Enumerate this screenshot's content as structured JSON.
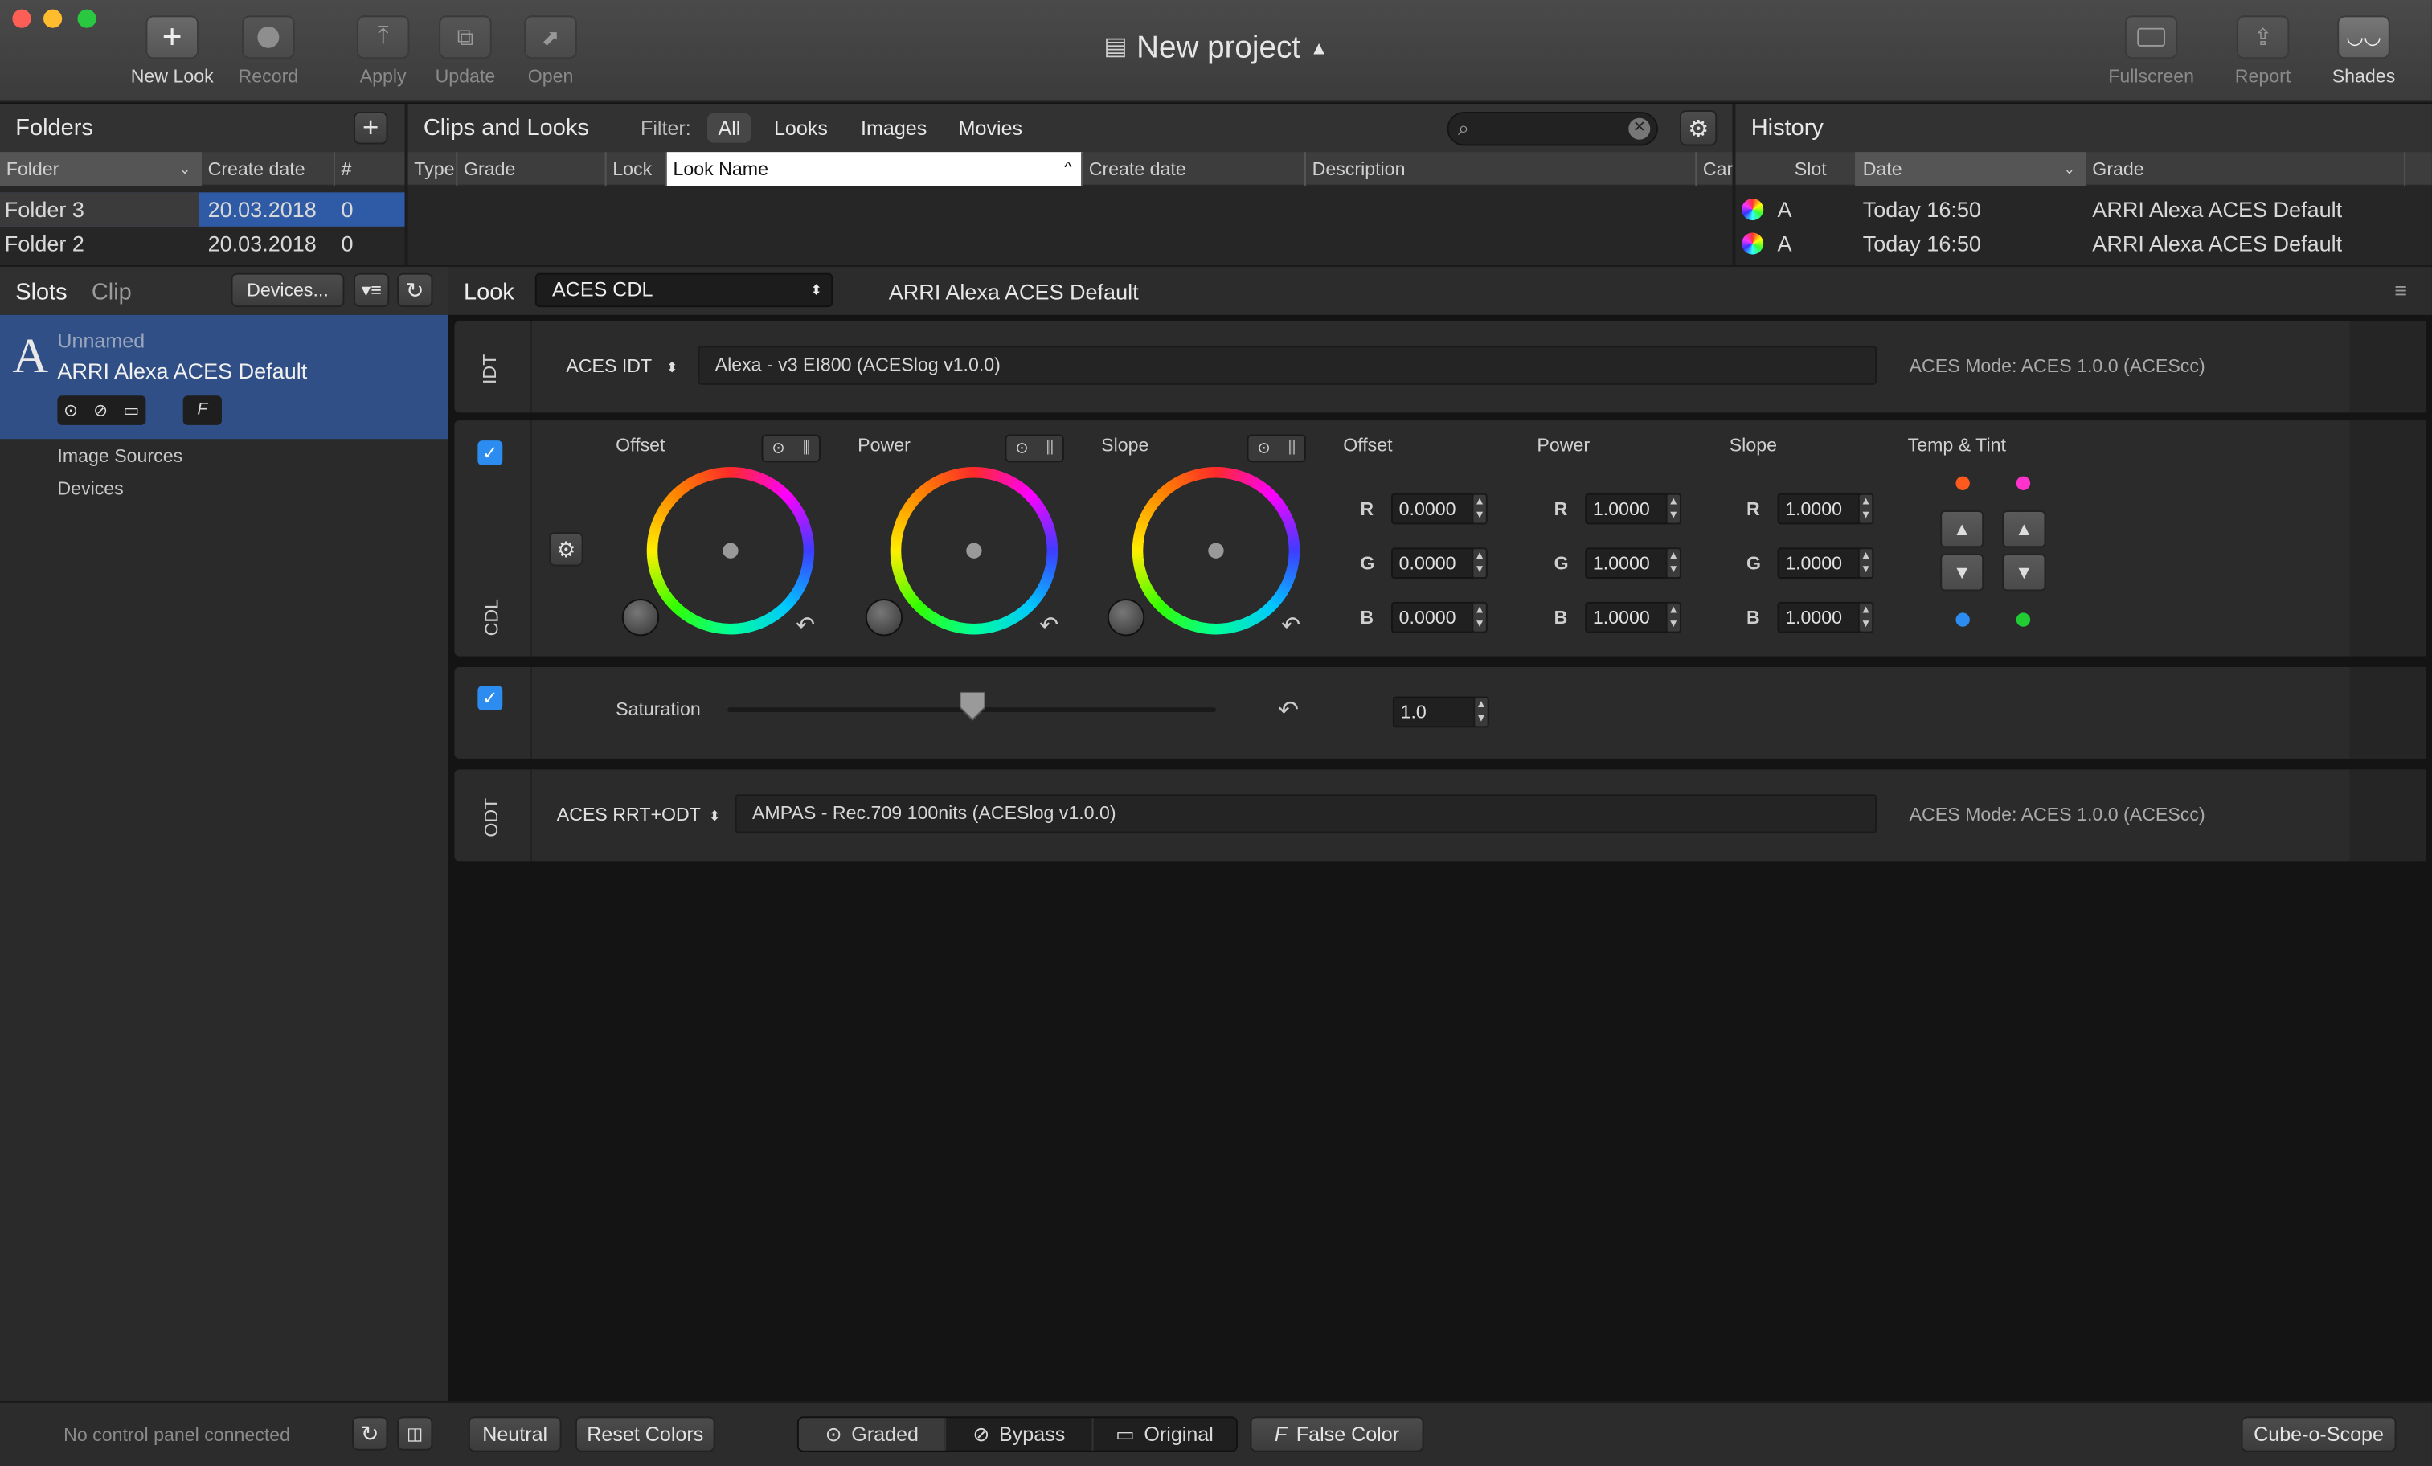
{
  "window": {
    "title": "New project"
  },
  "toolbar": {
    "new_look": "New Look",
    "record": "Record",
    "apply": "Apply",
    "update": "Update",
    "open": "Open",
    "fullscreen": "Fullscreen",
    "report": "Report",
    "shades": "Shades"
  },
  "folders": {
    "title": "Folders",
    "columns": [
      "Folder",
      "Create date",
      "#"
    ],
    "rows": [
      {
        "name": "Folder 3",
        "date": "20.03.2018",
        "count": "0"
      },
      {
        "name": "Folder 2",
        "date": "20.03.2018",
        "count": "0"
      }
    ]
  },
  "clips": {
    "title": "Clips and Looks",
    "filter_label": "Filter:",
    "filters": [
      "All",
      "Looks",
      "Images",
      "Movies"
    ],
    "columns": [
      "Type",
      "Grade",
      "Lock",
      "Look Name",
      "Create date",
      "Description",
      "Car"
    ]
  },
  "history": {
    "title": "History",
    "columns": [
      "Slot",
      "Date",
      "Grade"
    ],
    "rows": [
      {
        "slot": "A",
        "date": "Today 16:50",
        "grade": "ARRI Alexa ACES Default"
      },
      {
        "slot": "A",
        "date": "Today 16:50",
        "grade": "ARRI Alexa ACES Default"
      }
    ]
  },
  "slots": {
    "tab_slots": "Slots",
    "tab_clip": "Clip",
    "devices_button": "Devices...",
    "slot_letter": "A",
    "slot_name": "Unnamed",
    "slot_grade": "ARRI Alexa ACES Default",
    "slot_f": "F",
    "items": [
      "Image Sources",
      "Devices"
    ]
  },
  "look": {
    "label": "Look",
    "type": "ACES CDL",
    "name": "ARRI Alexa ACES Default"
  },
  "idt": {
    "side_label": "IDT",
    "select_label": "ACES IDT",
    "value": "Alexa - v3 EI800 (ACESlog v1.0.0)",
    "mode": "ACES Mode: ACES 1.0.0 (ACEScc)"
  },
  "cdl": {
    "side_label": "CDL",
    "wheels": [
      "Offset",
      "Power",
      "Slope"
    ],
    "groups": [
      {
        "title": "Offset",
        "r": "0.0000",
        "g": "0.0000",
        "b": "0.0000"
      },
      {
        "title": "Power",
        "r": "1.0000",
        "g": "1.0000",
        "b": "1.0000"
      },
      {
        "title": "Slope",
        "r": "1.0000",
        "g": "1.0000",
        "b": "1.0000"
      }
    ],
    "channel_labels": [
      "R",
      "G",
      "B"
    ],
    "temp_tint": "Temp & Tint"
  },
  "saturation": {
    "label": "Saturation",
    "value": "1.0",
    "level": 0.5
  },
  "odt": {
    "side_label": "ODT",
    "select_label": "ACES RRT+ODT",
    "value": "AMPAS - Rec.709 100nits (ACESlog v1.0.0)",
    "mode": "ACES Mode: ACES 1.0.0 (ACEScc)"
  },
  "bottombar": {
    "status": "No control panel connected",
    "neutral": "Neutral",
    "reset_colors": "Reset Colors",
    "graded": "Graded",
    "bypass": "Bypass",
    "original": "Original",
    "false_color": "False Color",
    "scope": "Cube-o-Scope"
  },
  "colors": {
    "selection": "#2f5aa5",
    "accent": "#2d8cf0",
    "temp_warm": "#ff5a1e",
    "tint_magenta": "#ff33cc",
    "temp_cool": "#2d8cf0",
    "tint_green": "#22cc33"
  }
}
